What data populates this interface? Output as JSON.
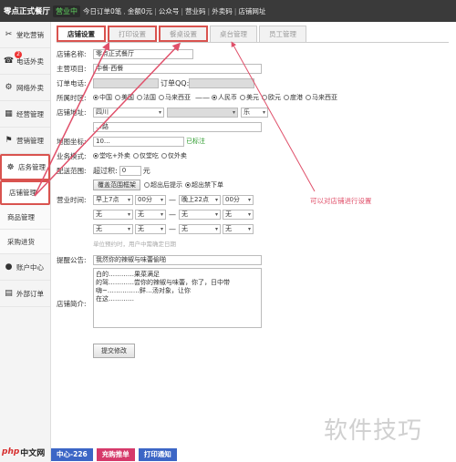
{
  "topbar": {
    "brand": "零点正式餐厅",
    "status": "营业中",
    "today_orders": "今日订单0笔",
    "amount": "金额0元",
    "account": "公众号",
    "business": "营业码",
    "takeout": "外卖码",
    "store_url": "店铺网址"
  },
  "sidebar": {
    "items": [
      {
        "label": "堂吃营销",
        "icon": "✂"
      },
      {
        "label": "电话外卖",
        "icon": "☎",
        "badge": "2"
      },
      {
        "label": "网络外卖",
        "icon": "⚙"
      },
      {
        "label": "经营管理",
        "icon": "▦"
      },
      {
        "label": "营销管理",
        "icon": "⚑"
      },
      {
        "label": "店务管理",
        "icon": "☸"
      }
    ],
    "subitems": [
      {
        "label": "店铺管理"
      },
      {
        "label": "商品管理"
      },
      {
        "label": "采购进货"
      }
    ],
    "items2": [
      {
        "label": "账户中心",
        "icon": "●"
      },
      {
        "label": "外部订单",
        "icon": "▤"
      }
    ]
  },
  "tabs": [
    {
      "label": "店铺设置"
    },
    {
      "label": "打印设置"
    },
    {
      "label": "餐桌设置"
    },
    {
      "label": "桌台管理"
    },
    {
      "label": "员工管理"
    }
  ],
  "form": {
    "name_label": "店铺名称:",
    "name_value": "零点正式餐厅",
    "project_label": "主营项目:",
    "project_value": "中餐·西餐",
    "phone_label": "订单电话:",
    "qq_label": "订单QQ:",
    "timezone_label": "所属时区:",
    "timezones": [
      "中国",
      "美国",
      "法国",
      "马来西亚"
    ],
    "currencies": [
      "人民币",
      "美元",
      "欧元",
      "度港",
      "马来西亚"
    ],
    "address_label": "店铺地址:",
    "province": "四川",
    "city": "",
    "district": "乐",
    "street": "…路",
    "geo_label": "地图坐标:",
    "geo_value": "10…",
    "geo_tag": "已标注",
    "mode_label": "业务模式:",
    "modes": [
      "堂吃+外卖",
      "仅堂吃",
      "仅外卖"
    ],
    "delivery_label": "配送范围:",
    "delivery_prefix": "超过积:",
    "delivery_value": "0",
    "delivery_unit": "元",
    "range_button": "覆盖范围框架",
    "range_opts": [
      "超出后提示",
      "超出禁下单"
    ],
    "hours_label": "营业时间:",
    "open_h": "早上7点",
    "open_m": "00分",
    "close_h": "晚上22点",
    "close_m": "00分",
    "none_opt": "无",
    "hours_dash": "—",
    "hours_note": "单位预约时，用户中需确定日期",
    "notice_label": "提醒公告:",
    "notice_value": "我然你的辣椒与味蕾偷啪",
    "intro_label": "店铺简介:",
    "intro_line1": "白的…………果菜满足",
    "intro_line2": "的驾…………尝你的辣椒与味蕾，你了，日中带",
    "intro_line3": "嗨~……………鲜…汤对象，让你",
    "intro_line4": "在这…………",
    "submit": "提交修改"
  },
  "annotation": "可以对店铺进行设置",
  "bottom": {
    "btn1": "中心-226",
    "btn2": "充购推单",
    "btn3": "打印通知",
    "logo1": "php",
    "logo2": "中文网",
    "watermark": "软件技巧"
  },
  "colors": {
    "highlight": "#d9534f",
    "arrow": "#e0506a",
    "btn1": "#3c66c6",
    "btn2": "#d6396a",
    "btn3": "#3c66c6"
  }
}
